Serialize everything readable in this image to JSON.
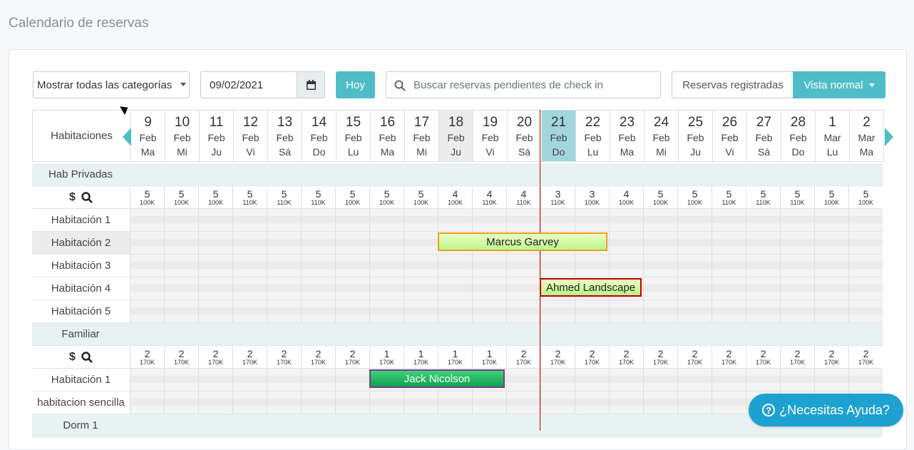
{
  "page_title": "Calendario de reservas",
  "toolbar": {
    "category_select": "Mostrar todas las categorías",
    "date_value": "09/02/2021",
    "today_label": "Hoy",
    "search_placeholder": "Buscar reservas pendientes de check in",
    "registered_label": "Reservas registradas",
    "view_label": "Vista normal"
  },
  "header": {
    "rooms_label": "Habitaciones"
  },
  "days": [
    {
      "n": "9",
      "m": "Feb",
      "w": "Ma"
    },
    {
      "n": "10",
      "m": "Feb",
      "w": "Mi"
    },
    {
      "n": "11",
      "m": "Feb",
      "w": "Ju"
    },
    {
      "n": "12",
      "m": "Feb",
      "w": "Vi"
    },
    {
      "n": "13",
      "m": "Feb",
      "w": "Sá"
    },
    {
      "n": "14",
      "m": "Feb",
      "w": "Do"
    },
    {
      "n": "15",
      "m": "Feb",
      "w": "Lu"
    },
    {
      "n": "16",
      "m": "Feb",
      "w": "Ma"
    },
    {
      "n": "17",
      "m": "Feb",
      "w": "Mi"
    },
    {
      "n": "18",
      "m": "Feb",
      "w": "Ju"
    },
    {
      "n": "19",
      "m": "Feb",
      "w": "Vi"
    },
    {
      "n": "20",
      "m": "Feb",
      "w": "Sá"
    },
    {
      "n": "21",
      "m": "Feb",
      "w": "Do"
    },
    {
      "n": "22",
      "m": "Feb",
      "w": "Lu"
    },
    {
      "n": "23",
      "m": "Feb",
      "w": "Ma"
    },
    {
      "n": "24",
      "m": "Feb",
      "w": "Mi"
    },
    {
      "n": "25",
      "m": "Feb",
      "w": "Ju"
    },
    {
      "n": "26",
      "m": "Feb",
      "w": "Vi"
    },
    {
      "n": "27",
      "m": "Feb",
      "w": "Sá"
    },
    {
      "n": "28",
      "m": "Feb",
      "w": "Do"
    },
    {
      "n": "1",
      "m": "Mar",
      "w": "Lu"
    },
    {
      "n": "2",
      "m": "Mar",
      "w": "Ma"
    }
  ],
  "categories": [
    {
      "name": "Hab Privadas",
      "availability": [
        {
          "a": "5",
          "p": "100K"
        },
        {
          "a": "5",
          "p": "100K"
        },
        {
          "a": "5",
          "p": "100K"
        },
        {
          "a": "5",
          "p": "110K"
        },
        {
          "a": "5",
          "p": "110K"
        },
        {
          "a": "5",
          "p": "110K"
        },
        {
          "a": "5",
          "p": "100K"
        },
        {
          "a": "5",
          "p": "100K"
        },
        {
          "a": "5",
          "p": "100K"
        },
        {
          "a": "4",
          "p": "100K"
        },
        {
          "a": "4",
          "p": "110K"
        },
        {
          "a": "4",
          "p": "110K"
        },
        {
          "a": "3",
          "p": "110K"
        },
        {
          "a": "3",
          "p": "100K"
        },
        {
          "a": "4",
          "p": "100K"
        },
        {
          "a": "5",
          "p": "100K"
        },
        {
          "a": "5",
          "p": "100K"
        },
        {
          "a": "5",
          "p": "110K"
        },
        {
          "a": "5",
          "p": "110K"
        },
        {
          "a": "5",
          "p": "110K"
        },
        {
          "a": "5",
          "p": "100K"
        },
        {
          "a": "5",
          "p": "100K"
        }
      ],
      "rooms": [
        "Habitación 1",
        "Habitación 2",
        "Habitación 3",
        "Habitación 4",
        "Habitación 5"
      ]
    },
    {
      "name": "Familiar",
      "availability": [
        {
          "a": "2",
          "p": "170K"
        },
        {
          "a": "2",
          "p": "170K"
        },
        {
          "a": "2",
          "p": "170K"
        },
        {
          "a": "2",
          "p": "170K"
        },
        {
          "a": "2",
          "p": "170K"
        },
        {
          "a": "2",
          "p": "170K"
        },
        {
          "a": "2",
          "p": "170K"
        },
        {
          "a": "1",
          "p": "170K"
        },
        {
          "a": "1",
          "p": "170K"
        },
        {
          "a": "1",
          "p": "170K"
        },
        {
          "a": "1",
          "p": "170K"
        },
        {
          "a": "2",
          "p": "170K"
        },
        {
          "a": "2",
          "p": "170K"
        },
        {
          "a": "2",
          "p": "170K"
        },
        {
          "a": "2",
          "p": "170K"
        },
        {
          "a": "2",
          "p": "170K"
        },
        {
          "a": "2",
          "p": "170K"
        },
        {
          "a": "2",
          "p": "170K"
        },
        {
          "a": "2",
          "p": "170K"
        },
        {
          "a": "2",
          "p": "170K"
        },
        {
          "a": "2",
          "p": "170K"
        },
        {
          "a": "2",
          "p": "170K"
        }
      ],
      "rooms": [
        "Habitación 1",
        "habitacion sencilla"
      ]
    },
    {
      "name": "Dorm 1"
    }
  ],
  "bookings": {
    "marcus": "Marcus Garvey",
    "ahmed": "Ahmed Landscape",
    "jack": "Jack Nicolson"
  },
  "help_label": "¿Necesitas Ayuda?",
  "colors": {
    "accent": "#4fbdc7",
    "today_line": "#b30000",
    "help": "#1da1d0"
  }
}
